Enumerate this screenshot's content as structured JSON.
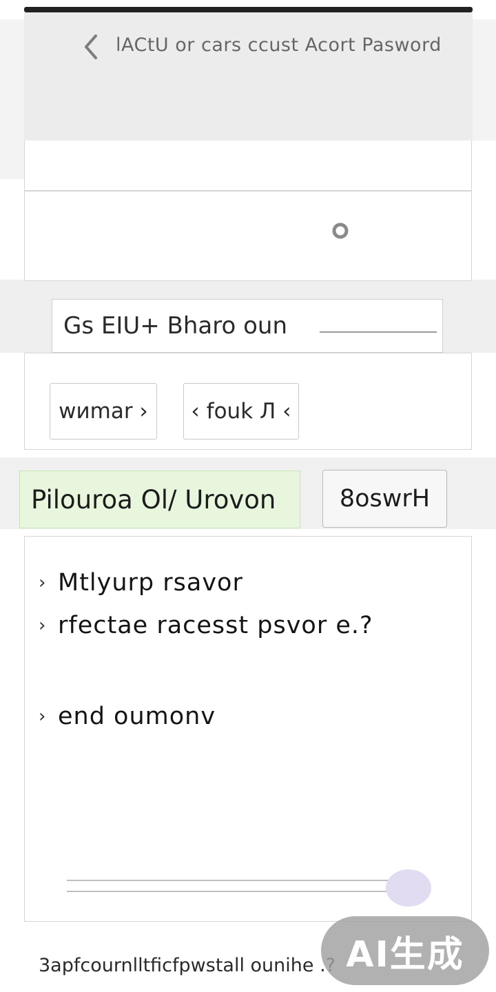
{
  "header": {
    "back_icon": "chevron-left-icon",
    "title": "lACtU or cars ccust Acort Pasword"
  },
  "search": {
    "value": "Gs EIU+ Bharo oun"
  },
  "chips": [
    {
      "label": "wиmar ›"
    },
    {
      "label": "‹ fouk Л ‹"
    }
  ],
  "actions": {
    "primary_label": "Pilouroa Ol/ Urovon",
    "secondary_label": "8oswrH"
  },
  "list": {
    "bullet": "›",
    "items": [
      "Mtlyurp rsavor",
      "rfectae racesst psvor e.?",
      "end oumonv"
    ]
  },
  "slider": {
    "value_fraction": 0.96
  },
  "footer": {
    "text": "3apfcournlltficfpwstall ounihe .?"
  },
  "watermark": {
    "text": "AI生成"
  },
  "colors": {
    "header_bg": "#ececec",
    "primary_btn_bg": "#e7f6dc",
    "slider_thumb": "#e1dcf1",
    "top_bar": "#222222"
  }
}
